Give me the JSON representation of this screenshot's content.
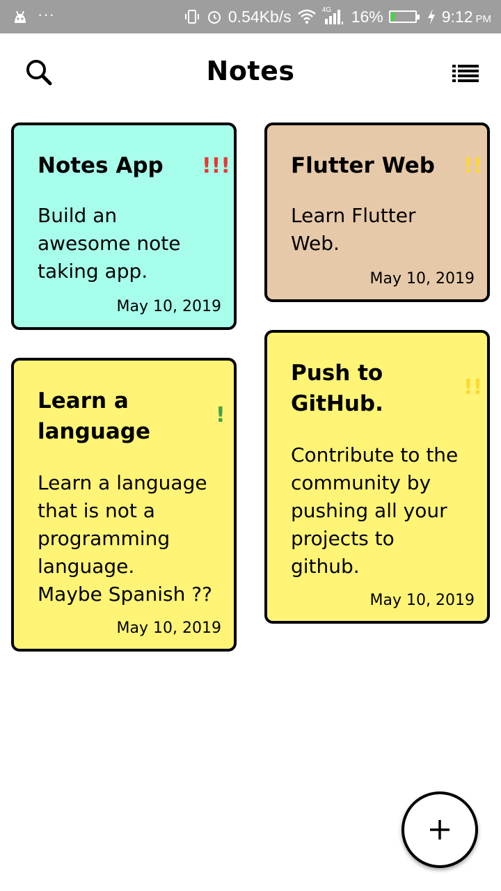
{
  "status_bar": {
    "network_speed": "0.54Kb/s",
    "network_type": "4G",
    "battery_percent": "16%",
    "battery_level": 0.16,
    "time": "9:12",
    "ampm": "PM",
    "dots": "···",
    "icons": [
      "android-icon",
      "vibrate-icon",
      "alarm-icon",
      "wifi-icon",
      "signal-icon",
      "battery-icon",
      "charging-icon"
    ]
  },
  "app_bar": {
    "title": "Notes",
    "left_icon": "search-icon",
    "right_icon": "list-view-icon"
  },
  "notes": [
    {
      "title": "Notes App",
      "body": "Build an\nawesome note\ntaking app.",
      "date": "May 10, 2019",
      "priority": "!!!",
      "priority_color": "#e53935",
      "color": "#a7ffeb"
    },
    {
      "title": "Flutter Web",
      "body": "Learn Flutter\nWeb.",
      "date": "May 10, 2019",
      "priority": "!!",
      "priority_color": "#fdd835",
      "color": "#e6c9a8"
    },
    {
      "title": "Learn a\nlanguage",
      "body": "Learn a language\nthat is not a\nprogramming\nlanguage.\nMaybe Spanish ??",
      "date": "May 10, 2019",
      "priority": "!",
      "priority_color": "#43a047",
      "color": "#fff475"
    },
    {
      "title": "Push to\nGitHub.",
      "body": "Contribute to the\ncommunity by\npushing all your\nprojects to\ngithub.",
      "date": "May 10, 2019",
      "priority": "!!",
      "priority_color": "#fdd835",
      "color": "#fff475"
    }
  ],
  "fab": {
    "icon": "plus-icon"
  }
}
